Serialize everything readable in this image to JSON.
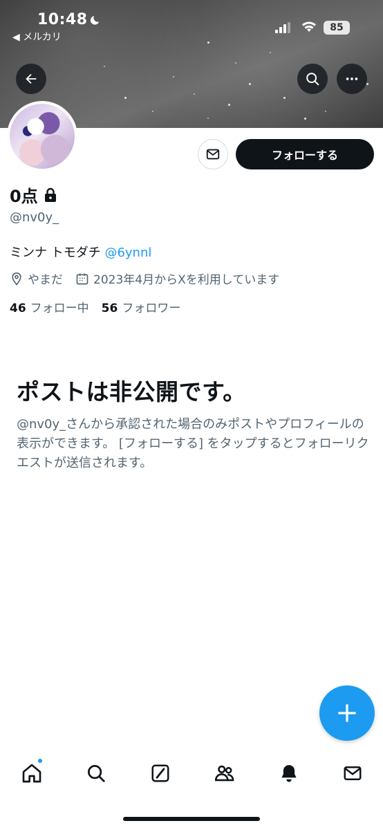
{
  "status_bar": {
    "time": "10:48",
    "back_app": "◀ メルカリ",
    "battery": "85"
  },
  "profile": {
    "display_name": "0点",
    "handle": "@nv0y_",
    "bio_text": "ミンナ トモダチ ",
    "bio_mention": "@6ynnl",
    "location": "やまだ",
    "joined": "2023年4月からXを利用しています",
    "following_count": "46",
    "following_label": "フォロー中",
    "followers_count": "56",
    "followers_label": "フォロワー"
  },
  "actions": {
    "follow_label": "フォローする"
  },
  "private_notice": {
    "title": "ポストは非公開です。",
    "body": "@nv0y_さんから承認された場合のみポストやプロフィールの表示ができます。 [フォローする] をタップするとフォローリクエストが送信されます。"
  },
  "colors": {
    "accent": "#1d9bf0",
    "text": "#0f1419",
    "secondary": "#536471"
  },
  "icons": [
    "back-arrow-icon",
    "search-icon",
    "more-icon",
    "message-icon",
    "lock-icon",
    "location-icon",
    "calendar-icon",
    "plus-icon",
    "home-icon",
    "explore-icon",
    "grok-icon",
    "communities-icon",
    "notifications-icon",
    "messages-icon"
  ]
}
